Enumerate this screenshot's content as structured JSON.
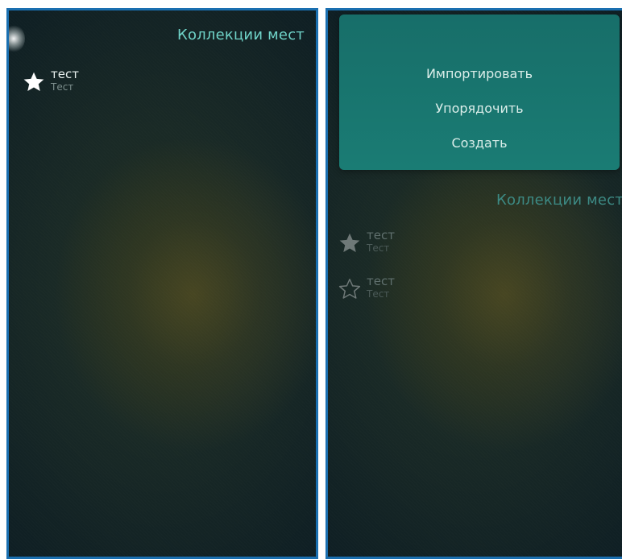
{
  "left_screen": {
    "title": "Коллекции мест",
    "collections": [
      {
        "name": "тест",
        "subtitle": "Тест",
        "icon": "star-filled-icon"
      }
    ]
  },
  "right_screen": {
    "title": "Коллекции мест",
    "menu": {
      "items": [
        {
          "label": "Импортировать"
        },
        {
          "label": "Упорядочить"
        },
        {
          "label": "Создать"
        }
      ]
    },
    "collections": [
      {
        "name": "тест",
        "subtitle": "Тест",
        "icon": "star-filled-icon"
      },
      {
        "name": "тест",
        "subtitle": "Тест",
        "icon": "star-outline-icon"
      }
    ]
  },
  "colors": {
    "accent_title": "#6fd3c8",
    "menu_background": "#1a7c74",
    "frame_border": "#1a6fb0"
  }
}
